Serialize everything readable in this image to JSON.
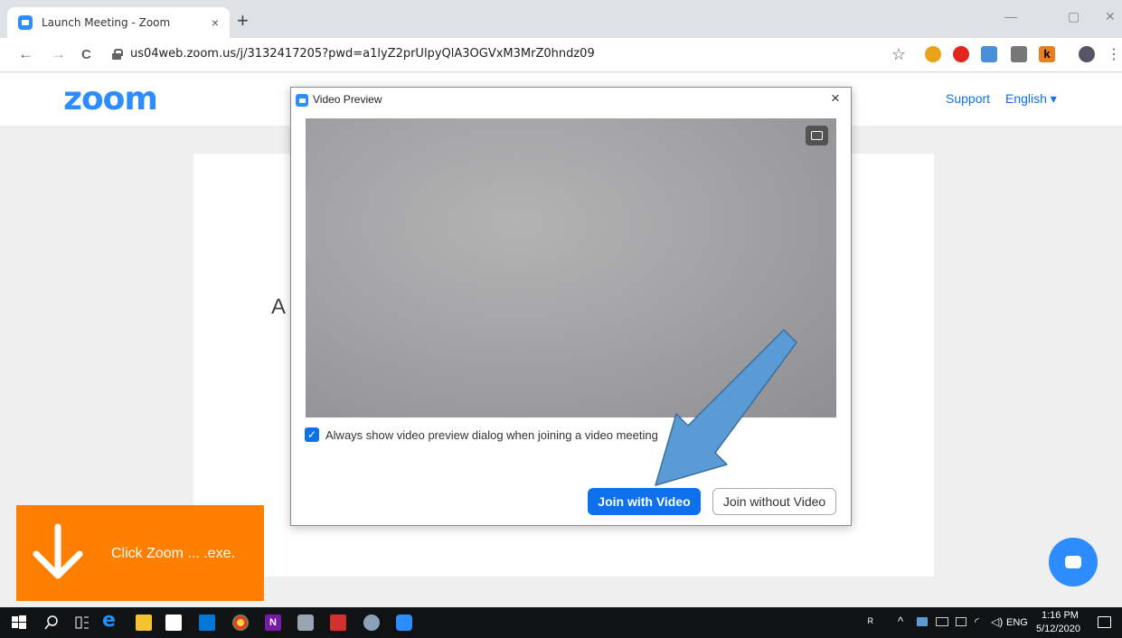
{
  "browser": {
    "tab_title": "Launch Meeting - Zoom",
    "tab_close": "×",
    "new_tab": "+",
    "url": "us04web.zoom.us/j/3132417205?pwd=a1lyZ2prUlpyQlA3OGVxM3MrZ0hndz09",
    "back": "←",
    "forward": "→",
    "reload": "C",
    "star": "☆",
    "menu": "⋮",
    "minimize": "—",
    "restore": "▢",
    "close": "✕"
  },
  "zoom_page": {
    "logo": "zoom",
    "support_link": "Support",
    "language": "English ▾",
    "card_partial_text": "A"
  },
  "dialog": {
    "title": "Video Preview",
    "close": "×",
    "checkbox_label": "Always show video preview dialog when joining a video meeting",
    "checkbox_checked": true,
    "join_with_video": "Join with Video",
    "join_without_video": "Join without Video"
  },
  "download": {
    "label": "Click Zoom ... .exe."
  },
  "taskbar": {
    "time": "1:16 PM",
    "date": "5/12/2020",
    "lang": "ENG"
  },
  "colors": {
    "zoom_blue": "#2d8cff",
    "button_blue": "#0e71eb",
    "banner_orange": "#ff8000",
    "annotation_arrow": "#5b9bd5"
  }
}
